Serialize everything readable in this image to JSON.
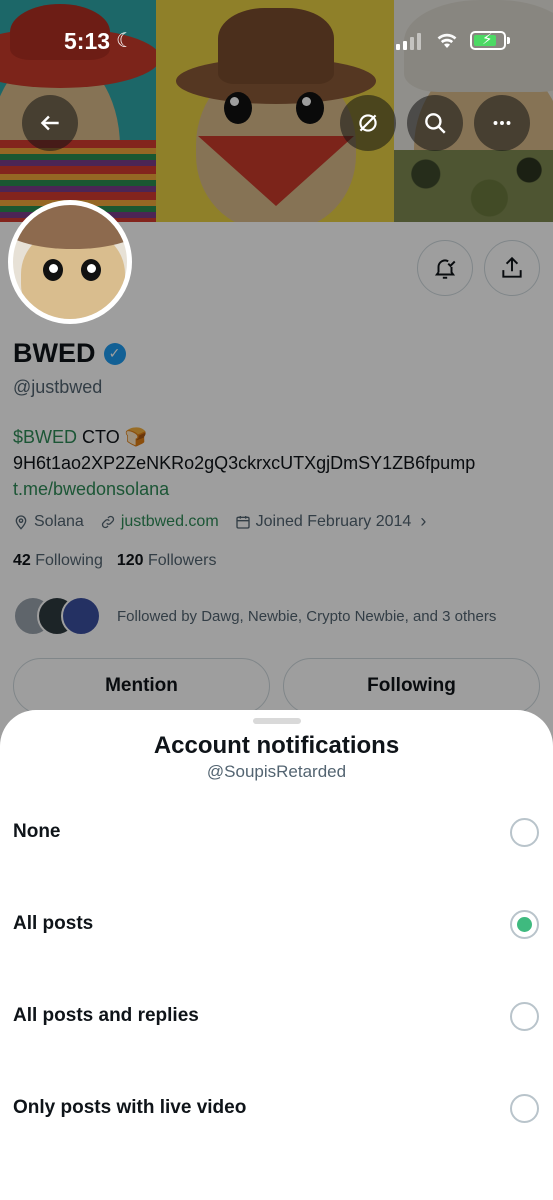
{
  "status_bar": {
    "time": "5:13"
  },
  "profile": {
    "display_name": "BWED",
    "handle": "@justbwed",
    "bio_ticker": "$BWED",
    "bio_cto": "CTO 🍞",
    "bio_contract": "9H6t1ao2XP2ZeNKRo2gQ3ckrxcUTXgjDmSY1ZB6fpump",
    "bio_link": "t.me/bwedonsolana",
    "location": "Solana",
    "website": "justbwed.com",
    "joined": "Joined February 2014",
    "following_count": "42",
    "following_label": "Following",
    "followers_count": "120",
    "followers_label": "Followers",
    "followed_by": "Followed by Dawg, Newbie, Crypto Newbie, and 3 others"
  },
  "actions": {
    "mention": "Mention",
    "following": "Following"
  },
  "sheet": {
    "title": "Account notifications",
    "subtitle": "@SoupisRetarded",
    "options": [
      {
        "label": "None",
        "selected": false
      },
      {
        "label": "All posts",
        "selected": true
      },
      {
        "label": "All posts and replies",
        "selected": false
      },
      {
        "label": "Only posts with live video",
        "selected": false
      }
    ]
  },
  "colors": {
    "accent_green": "#3fba7f",
    "link_green": "#2e8b57",
    "verified_blue": "#1d9bf0"
  },
  "icons": [
    "back-arrow-icon",
    "translate-off-icon",
    "search-icon",
    "more-icon",
    "bell-check-icon",
    "share-icon",
    "location-icon",
    "link-icon",
    "calendar-icon",
    "chevron-right-icon",
    "verified-icon"
  ]
}
